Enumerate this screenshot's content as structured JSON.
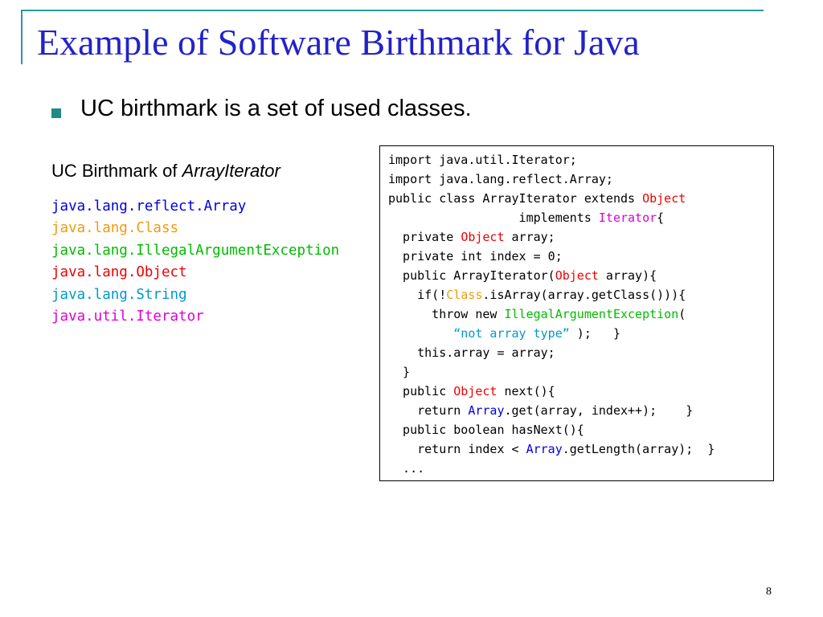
{
  "slide": {
    "title": "Example of Software Birthmark for Java",
    "bullet": "UC birthmark is a set of used classes.",
    "subhead_prefix": "UC Birthmark of ",
    "subhead_italic": "ArrayIterator",
    "page_number": "8"
  },
  "classes": [
    {
      "name": "java.lang.reflect.Array",
      "color": "#0000dd"
    },
    {
      "name": "java.lang.Class",
      "color": "#f39a0a"
    },
    {
      "name": "java.lang.IllegalArgumentException",
      "color": "#00bb00"
    },
    {
      "name": "java.lang.Object",
      "color": "#ee0000"
    },
    {
      "name": "java.lang.String",
      "color": "#0099cc"
    },
    {
      "name": "java.util.Iterator",
      "color": "#dd00dd"
    }
  ],
  "code": {
    "l1": "import java.util.Iterator;",
    "l2": "import java.lang.reflect.Array;",
    "l3a": "public class ArrayIterator extends ",
    "l3b": "Object",
    "l4a": "                  implements ",
    "l4b": "Iterator",
    "l4c": "{",
    "l5a": "  private ",
    "l5b": "Object",
    "l5c": " array;",
    "l6": "  private int index = 0;",
    "l7a": "  public ArrayIterator(",
    "l7b": "Object",
    "l7c": " array){",
    "l8a": "    if(!",
    "l8b": "Class",
    "l8c": ".isArray(array.getClass())){",
    "l9a": "      throw new ",
    "l9b": "IllegalArgumentException",
    "l9c": "(",
    "l10a": "         ",
    "l10b": "“not array type”",
    "l10c": " );   }",
    "l11": "    this.array = array;",
    "l12": "  }",
    "l13a": "  public ",
    "l13b": "Object",
    "l13c": " next(){",
    "l14a": "    return ",
    "l14b": "Array",
    "l14c": ".get(array, index++);    }",
    "l15": "  public boolean hasNext(){",
    "l16a": "    return index < ",
    "l16b": "Array",
    "l16c": ".getLength(array);  }",
    "l17": "  ..."
  }
}
